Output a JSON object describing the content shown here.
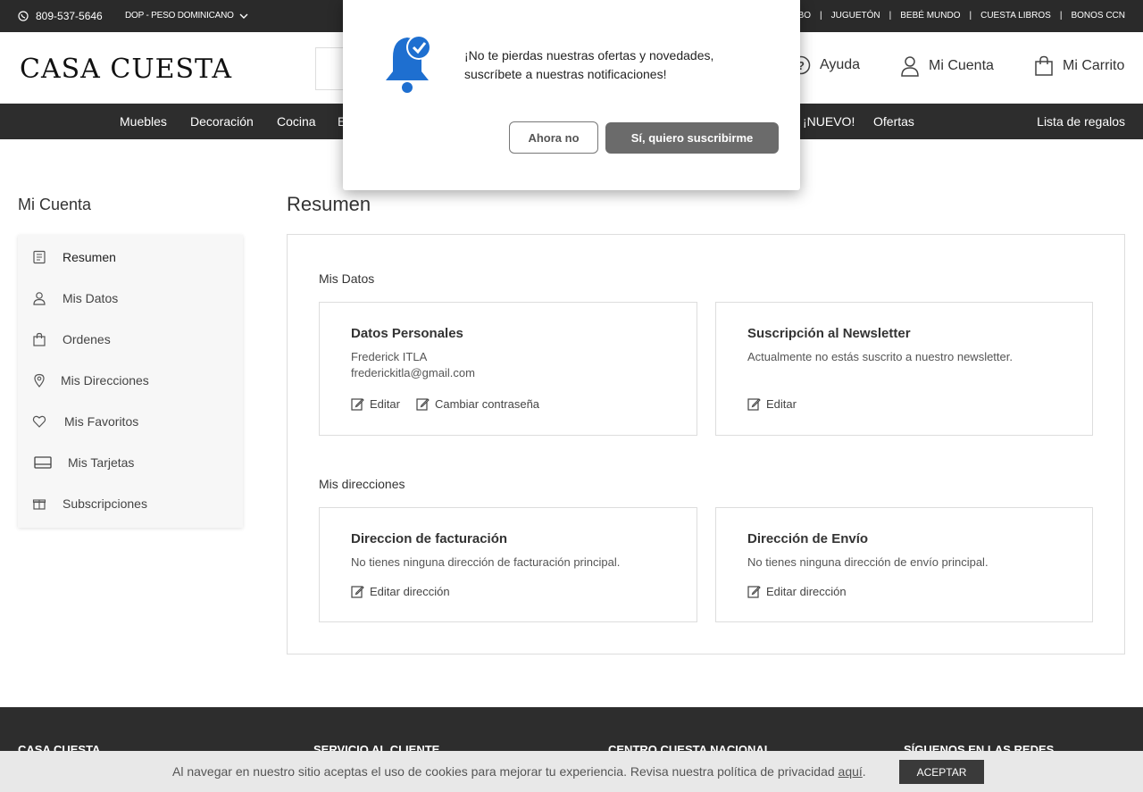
{
  "topbar": {
    "phone": "809-537-5646",
    "currency": "DOP - PESO DOMINICANO",
    "links": [
      "MBO",
      "JUGUETÓN",
      "BEBÉ MUNDO",
      "CUESTA LIBROS",
      "BONOS CCN"
    ]
  },
  "header": {
    "logo": "CASA CUESTA",
    "help": "Ayuda",
    "account": "Mi Cuenta",
    "cart": "Mi Carrito"
  },
  "nav": {
    "items": [
      "Muebles",
      "Decoración",
      "Cocina",
      "E",
      "¡NUEVO!",
      "Ofertas"
    ],
    "gift_list": "Lista de regalos"
  },
  "popup": {
    "message": "¡No te pierdas nuestras ofertas y novedades, suscríbete a nuestras notificaciones!",
    "no_label": "Ahora no",
    "yes_label": "Sí, quiero suscribirme"
  },
  "sidebar": {
    "title": "Mi Cuenta",
    "items": [
      {
        "label": "Resumen",
        "icon": "document-icon"
      },
      {
        "label": "Mis Datos",
        "icon": "user-icon"
      },
      {
        "label": "Ordenes",
        "icon": "bag-icon"
      },
      {
        "label": "Mis Direcciones",
        "icon": "location-pin-icon"
      },
      {
        "label": "Mis Favoritos",
        "icon": "heart-icon"
      },
      {
        "label": "Mis Tarjetas",
        "icon": "card-icon"
      },
      {
        "label": "Subscripciones",
        "icon": "gift-icon"
      }
    ]
  },
  "main": {
    "title": "Resumen",
    "section_data": "Mis Datos",
    "section_addresses": "Mis direcciones",
    "personal": {
      "title": "Datos Personales",
      "name": "Frederick ITLA",
      "email": "frederickitla@gmail.com",
      "edit": "Editar",
      "change_password": "Cambiar contraseña"
    },
    "newsletter": {
      "title": "Suscripción al Newsletter",
      "text": "Actualmente no estás suscrito a nuestro newsletter.",
      "edit": "Editar"
    },
    "billing": {
      "title": "Direccion de facturación",
      "text": "No tienes ninguna dirección de facturación principal.",
      "edit": "Editar dirección"
    },
    "shipping": {
      "title": "Dirección de Envío",
      "text": "No tienes ninguna dirección de envío principal.",
      "edit": "Editar dirección"
    }
  },
  "footer": {
    "cols": [
      "CASA CUESTA",
      "SERVICIO AL CLIENTE",
      "CENTRO CUESTA NACIONAL",
      "SÍGUENOS EN LAS REDES"
    ]
  },
  "cookie": {
    "text": "Al navegar en nuestro sitio aceptas el uso de cookies para mejorar tu experiencia. Revisa nuestra política de privacidad ",
    "link": "aquí",
    "end": ".",
    "accept": "ACEPTAR"
  },
  "colors": {
    "dark": "#2d2d2d",
    "bell_blue": "#1e6fd0"
  }
}
